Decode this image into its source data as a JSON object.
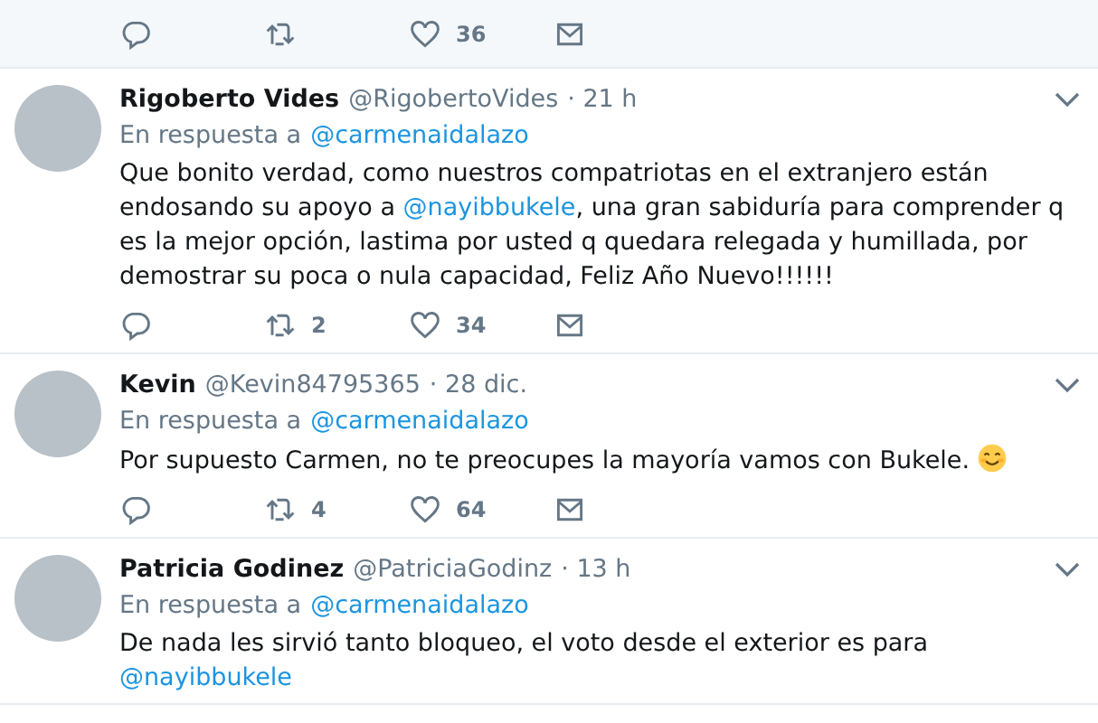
{
  "top_actions": {
    "likes": "36"
  },
  "tweets": [
    {
      "name": "Rigoberto Vides",
      "handle": "@RigobertoVides",
      "time": "· 21 h",
      "reply_label": "En respuesta a",
      "reply_to": "@carmenaidalazo",
      "body": [
        {
          "kind": "text",
          "text": "Que bonito verdad, como nuestros compatriotas en el extranjero están endosando su apoyo a "
        },
        {
          "kind": "mention",
          "text": "@nayibbukele"
        },
        {
          "kind": "text",
          "text": ", una gran sabiduría para comprender q es la mejor opción, lastima por usted q quedara relegada y humillada, por demostrar su poca o nula capacidad, Feliz Año Nuevo!!!!!!"
        }
      ],
      "actions": {
        "retweets": "2",
        "likes": "34"
      }
    },
    {
      "name": "Kevin",
      "handle": "@Kevin84795365",
      "time": "· 28 dic.",
      "reply_label": "En respuesta a",
      "reply_to": "@carmenaidalazo",
      "body": [
        {
          "kind": "text",
          "text": "Por supuesto Carmen, no te preocupes la mayoría vamos con Bukele. "
        },
        {
          "kind": "emoji"
        }
      ],
      "actions": {
        "retweets": "4",
        "likes": "64"
      }
    },
    {
      "name": "Patricia Godinez",
      "handle": "@PatriciaGodinz",
      "time": "· 13 h",
      "reply_label": "En respuesta a",
      "reply_to": "@carmenaidalazo",
      "body": [
        {
          "kind": "text",
          "text": "De nada les sirvió tanto bloqueo, el voto desde el exterior es para "
        },
        {
          "kind": "mention",
          "text": "@nayibbukele"
        }
      ]
    }
  ]
}
